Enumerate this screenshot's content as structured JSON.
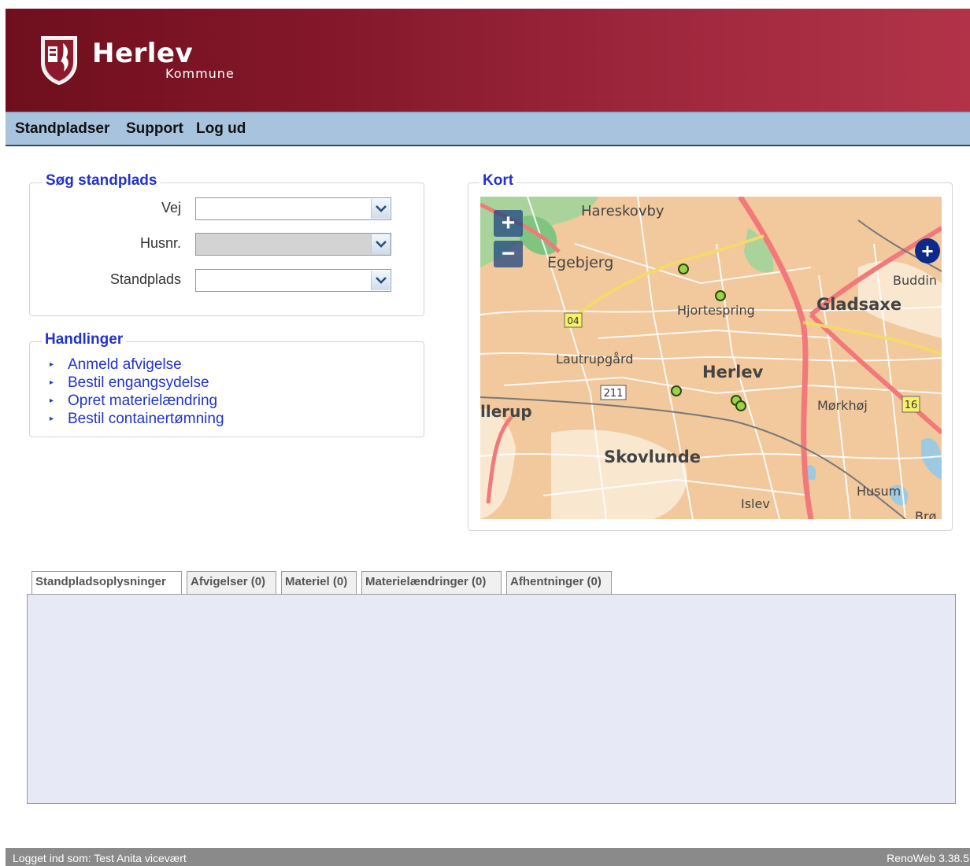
{
  "header": {
    "title": "Herlev",
    "subtitle": "Kommune",
    "logo_icon": "coat-of-arms-shield-icon"
  },
  "nav": {
    "items": [
      {
        "label": "Standpladser"
      },
      {
        "label": "Support"
      },
      {
        "label": "Log ud"
      }
    ]
  },
  "search": {
    "legend": "Søg standplads",
    "fields": [
      {
        "label": "Vej",
        "value": "",
        "disabled": false
      },
      {
        "label": "Husnr.",
        "value": "",
        "disabled": true
      },
      {
        "label": "Standplads",
        "value": "",
        "disabled": false
      }
    ]
  },
  "actions": {
    "legend": "Handlinger",
    "items": [
      {
        "label": "Anmeld afvigelse"
      },
      {
        "label": "Bestil engangsydelse"
      },
      {
        "label": "Opret materielændring"
      },
      {
        "label": "Bestil containertømning"
      }
    ]
  },
  "map": {
    "legend": "Kort",
    "zoom_in": "+",
    "zoom_out": "−",
    "layer_switcher": "+",
    "place_labels": {
      "hareskovby": "Hareskovby",
      "egebjerg": "Egebjerg",
      "hjortespring": "Hjortespring",
      "gladsaxe": "Gladsaxe",
      "buddinge": "Buddin",
      "lautrupgaard": "Lautrupgård",
      "herlev": "Herlev",
      "ballerup": "llerup",
      "morkhoj": "Mørkhøj",
      "skovlunde": "Skovlunde",
      "husum": "Husum",
      "islev": "Islev",
      "bro": "Brø"
    },
    "road_shields": [
      "04",
      "211",
      "16"
    ]
  },
  "tabs": [
    {
      "label": "Standpladsoplysninger",
      "active": true
    },
    {
      "label": "Afvigelser (0)",
      "active": false
    },
    {
      "label": "Materiel (0)",
      "active": false
    },
    {
      "label": "Materielændringer (0)",
      "active": false
    },
    {
      "label": "Afhentninger (0)",
      "active": false
    }
  ],
  "footer": {
    "logged_in": "Logget ind som: Test Anita vicevært",
    "version": "RenoWeb 3.38.5"
  },
  "colors": {
    "header_dark": "#6f0f1e",
    "header_light": "#b23348",
    "nav_bg": "#a7c3dd",
    "link_blue": "#2233cc",
    "tab_panel_bg": "#e7e9f7",
    "footer_bg": "#8a8a8a"
  }
}
